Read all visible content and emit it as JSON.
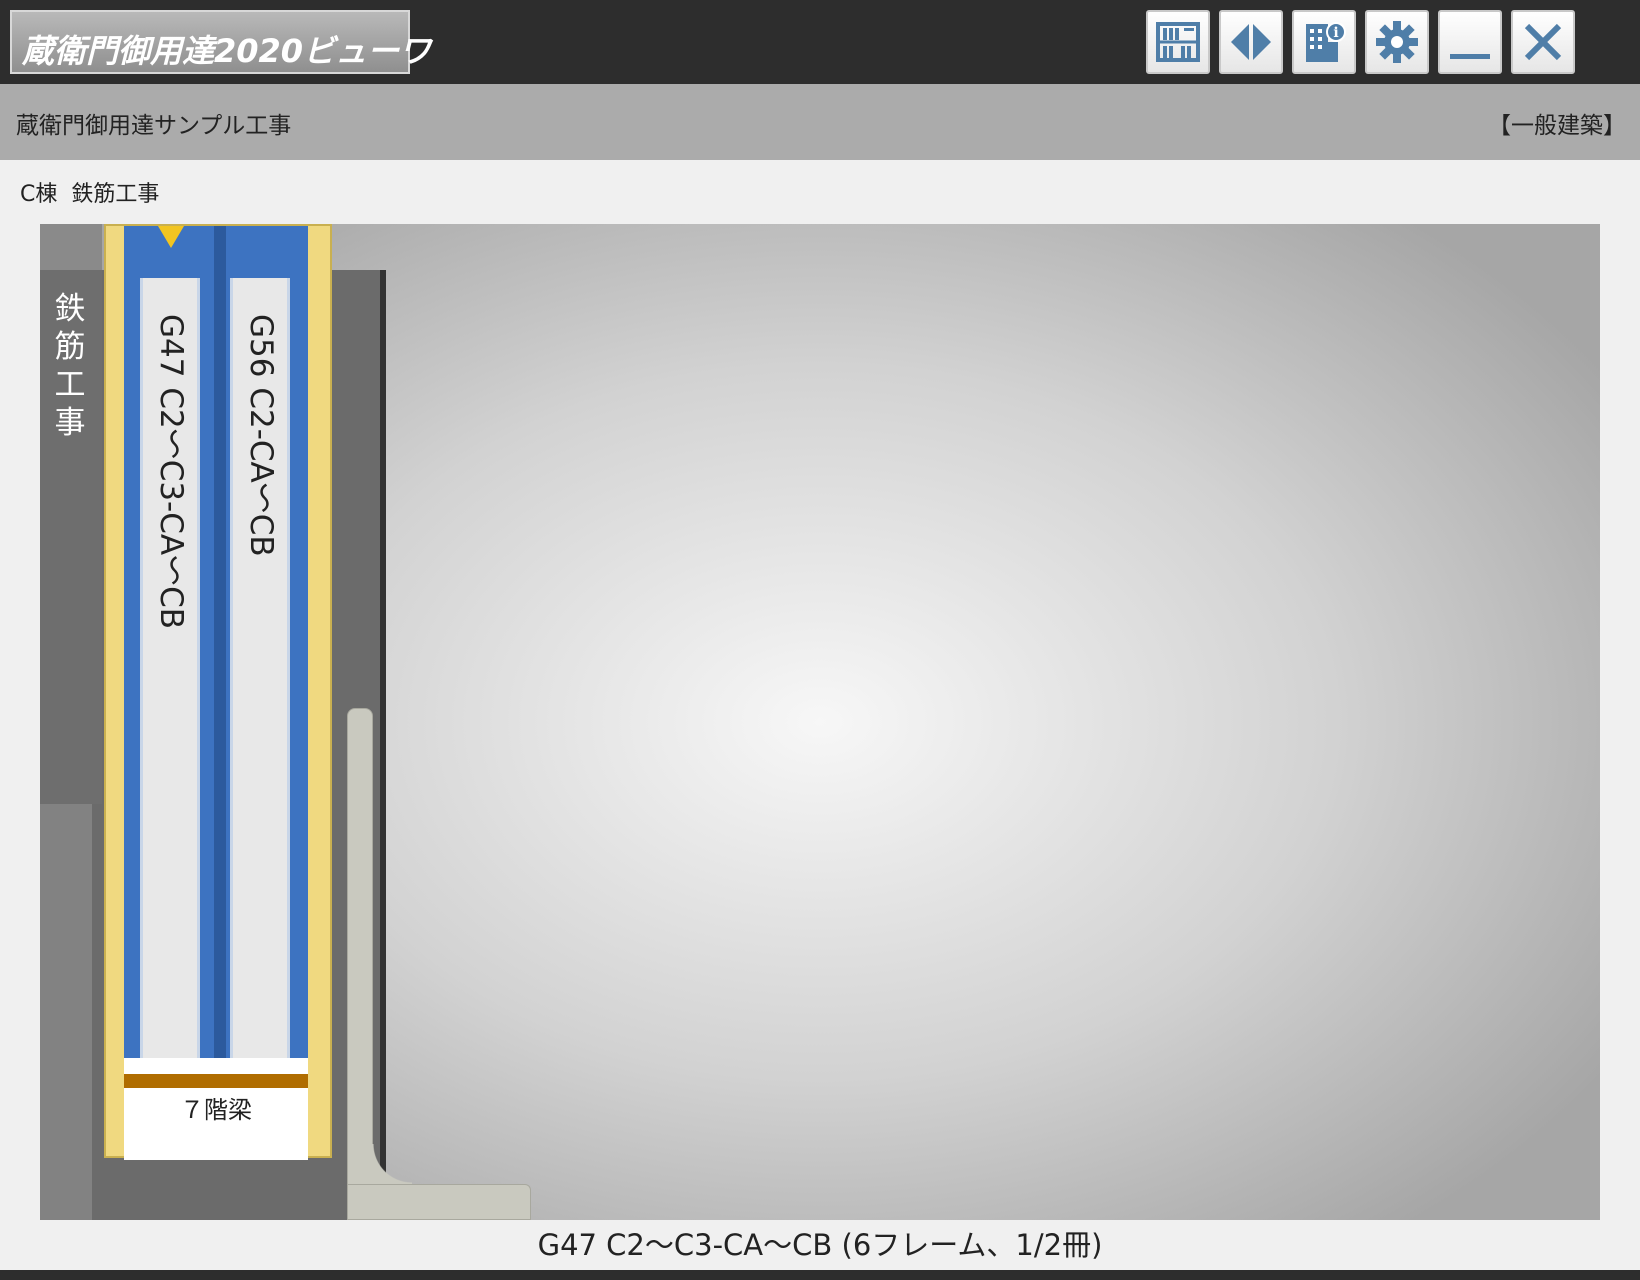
{
  "app": {
    "title": "蔵衛門御用達2020ビューワ"
  },
  "toolbar": {
    "buttons": [
      {
        "icon": "bookshelf-icon"
      },
      {
        "icon": "split-view-icon"
      },
      {
        "icon": "building-info-icon"
      },
      {
        "icon": "gear-icon"
      },
      {
        "icon": "minimize-icon"
      },
      {
        "icon": "close-icon"
      }
    ]
  },
  "project": {
    "name": "蔵衛門御用達サンプル工事",
    "category": "【一般建築】"
  },
  "breadcrumb": {
    "building": "C棟",
    "work": "鉄筋工事"
  },
  "shelf": {
    "tab_label": "鉄筋工事",
    "binder": {
      "spines": [
        "G47 C2～C3-CA～CB",
        "G56 C2-CA～CB"
      ],
      "caption": "７階梁"
    }
  },
  "status": {
    "selection": "G47 C2～C3-CA～CB (6フレーム、1/2冊)"
  },
  "colors": {
    "titlebar": "#2d2d2d",
    "binder_blue": "#3d73c1",
    "binder_gold": "#f0d980",
    "icon_blue": "#4f7ea8"
  }
}
